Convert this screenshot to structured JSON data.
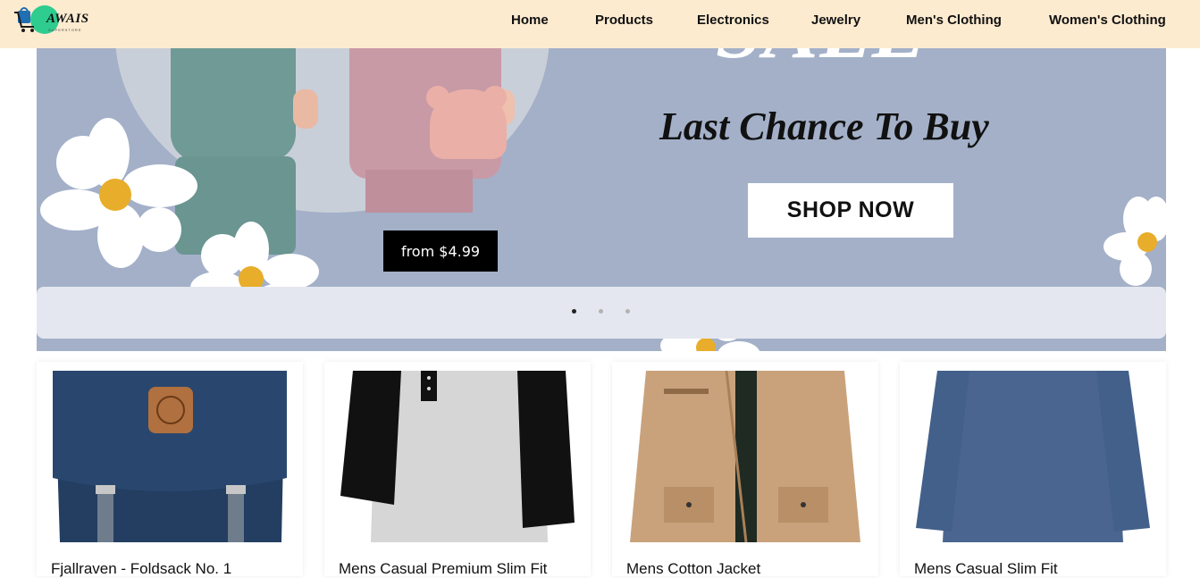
{
  "header": {
    "brand": "AWAIS",
    "brand_tagline": "SUPERSTORE",
    "nav": [
      "Home",
      "Products",
      "Electronics",
      "Jewelry",
      "Men's Clothing",
      "Women's Clothing"
    ]
  },
  "hero": {
    "headline": "SALE",
    "tagline": "Last Chance To Buy",
    "cta_label": "SHOP NOW",
    "price_label": "from $4.99",
    "slides": 3,
    "active_slide": 1
  },
  "products": [
    {
      "title": "Fjallraven - Foldsack No. 1"
    },
    {
      "title": "Mens Casual Premium Slim Fit"
    },
    {
      "title": "Mens Cotton Jacket"
    },
    {
      "title": "Mens Casual Slim Fit"
    }
  ],
  "colors": {
    "header_bg": "#fdebd0",
    "hero_bg": "#a3b0c8",
    "flower_center": "#e8ad2a"
  }
}
